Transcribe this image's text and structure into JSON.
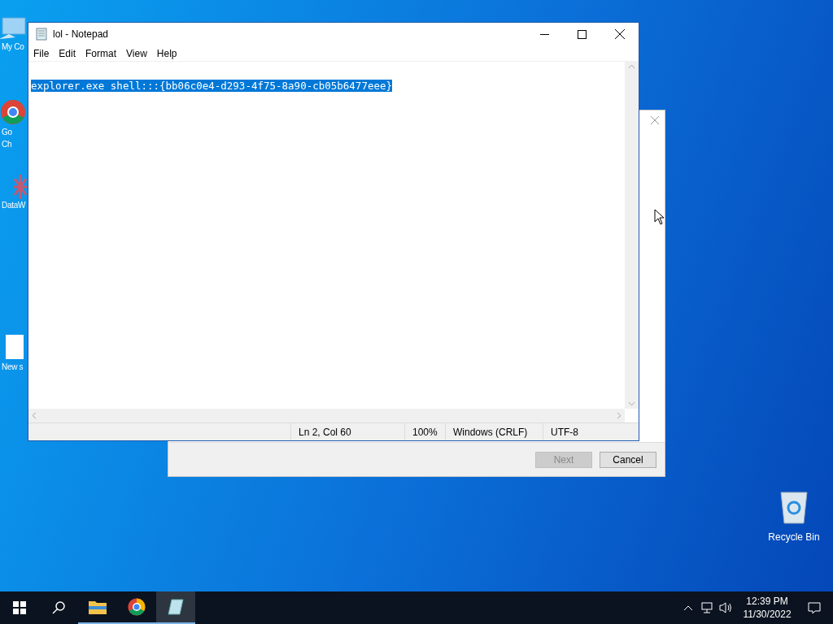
{
  "desktop_icons": [
    {
      "kind": "computer",
      "lines": [
        "My Co"
      ]
    },
    {
      "kind": "chrome",
      "lines": [
        "Go",
        "Ch"
      ]
    },
    {
      "kind": "app",
      "lines": [
        "DataW"
      ]
    },
    {
      "kind": "file",
      "lines": [
        "New s"
      ]
    }
  ],
  "recycle_bin": {
    "label": "Recycle Bin"
  },
  "dialog": {
    "buttons": [
      {
        "label": "Next",
        "disabled": true
      },
      {
        "label": "Cancel",
        "disabled": false
      }
    ]
  },
  "notepad": {
    "title": "lol - Notepad",
    "menu": [
      "File",
      "Edit",
      "Format",
      "View",
      "Help"
    ],
    "text": "explorer.exe shell:::{bb06c0e4-d293-4f75-8a90-cb05b6477eee}",
    "text_selected": true,
    "status": [
      "Ln 2, Col 60",
      "100%",
      "Windows (CRLF)",
      "UTF-8"
    ]
  },
  "taskbar": {
    "apps": [
      {
        "kind": "folder",
        "selected": false
      },
      {
        "kind": "chrome",
        "selected": false
      },
      {
        "kind": "notepad",
        "selected": true
      }
    ],
    "time": "12:39 PM",
    "date": "11/30/2022"
  }
}
